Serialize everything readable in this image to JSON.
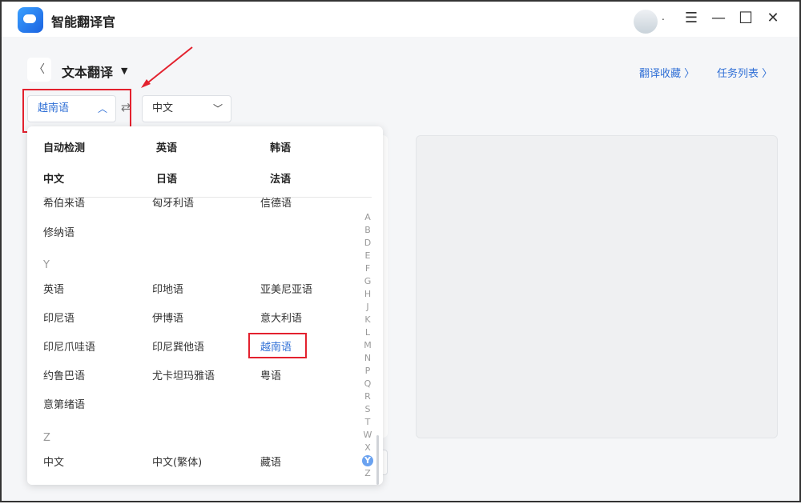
{
  "app": {
    "title": "智能翻译官"
  },
  "window": {
    "avatar_suffix": "."
  },
  "header": {
    "title": "文本翻译",
    "links": [
      "翻译收藏 〉",
      "任务列表 〉"
    ]
  },
  "source_lang": "越南语",
  "target_lang": "中文",
  "dropdown": {
    "pinned": [
      [
        "自动检测",
        "英语",
        "韩语"
      ],
      [
        "中文",
        "日语",
        "法语"
      ]
    ],
    "partial_row": [
      "希伯来语",
      "匈牙利语",
      "信德语"
    ],
    "x_rest": [
      "修纳语"
    ],
    "groups": [
      {
        "letter": "Y",
        "rows": [
          [
            "英语",
            "印地语",
            "亚美尼亚语"
          ],
          [
            "印尼语",
            "伊博语",
            "意大利语"
          ],
          [
            "印尼爪哇语",
            "印尼巽他语",
            "越南语"
          ],
          [
            "约鲁巴语",
            "尤卡坦玛雅语",
            "粤语"
          ],
          [
            "意第绪语"
          ]
        ]
      },
      {
        "letter": "Z",
        "rows": [
          [
            "中文",
            "中文(繁体)",
            "藏语"
          ]
        ]
      }
    ],
    "selected": "越南语",
    "alphabet": [
      "A",
      "B",
      "D",
      "E",
      "F",
      "G",
      "H",
      "J",
      "K",
      "L",
      "M",
      "N",
      "P",
      "Q",
      "R",
      "S",
      "T",
      "W",
      "X",
      "Y",
      "Z"
    ],
    "active_letter": "Y"
  },
  "colors": {
    "accent": "#2f6fd6",
    "highlight": "#e3212e"
  }
}
